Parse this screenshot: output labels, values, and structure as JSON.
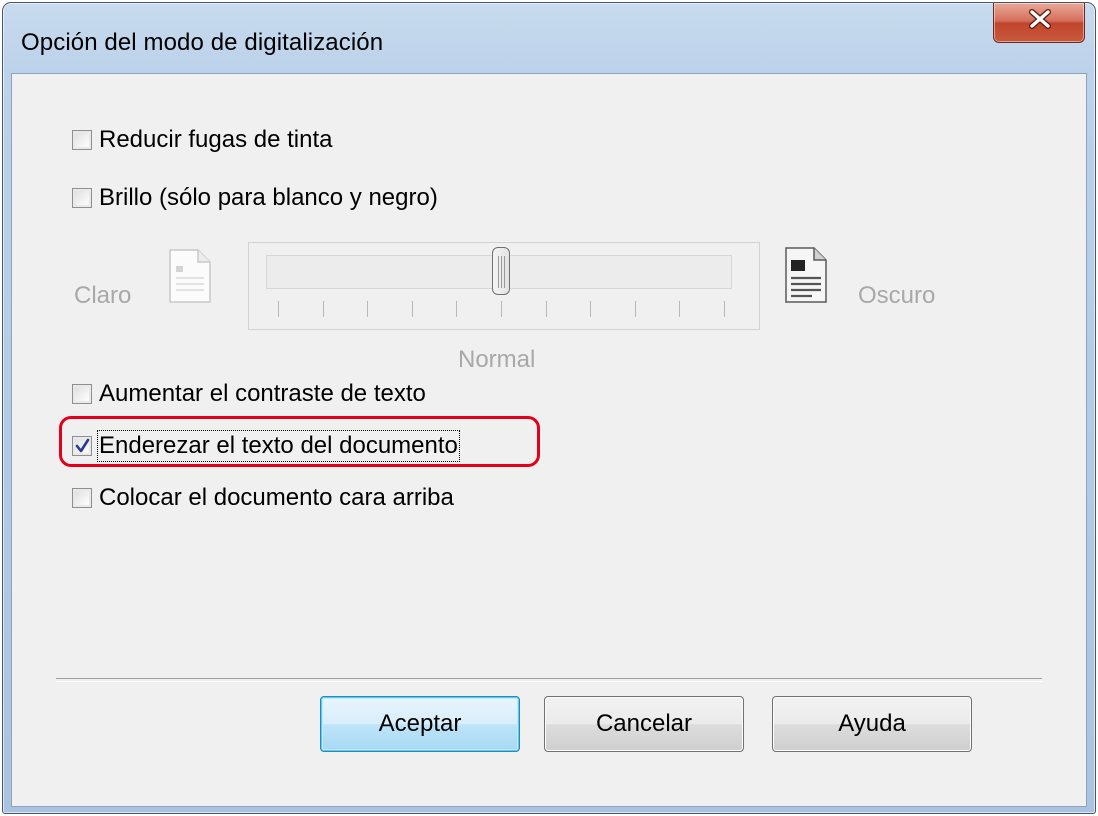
{
  "window": {
    "title": "Opción del modo de digitalización"
  },
  "options": [
    {
      "label": "Reducir fugas de tinta",
      "checked": false
    },
    {
      "label": "Brillo (sólo para blanco y negro)",
      "checked": false
    },
    {
      "label": "Aumentar el contraste de texto",
      "checked": false
    },
    {
      "label": "Enderezar el texto del documento",
      "checked": true
    },
    {
      "label": "Colocar el documento cara arriba",
      "checked": false
    }
  ],
  "brightness": {
    "left_label": "Claro",
    "right_label": "Oscuro",
    "center_label": "Normal",
    "value": 0.5,
    "enabled": false,
    "left_icon": "light-page-icon",
    "right_icon": "dark-page-icon"
  },
  "buttons": {
    "ok": "Aceptar",
    "cancel": "Cancelar",
    "help": "Ayuda"
  },
  "colors": {
    "highlight": "#e2001a",
    "close_button": "#c1442c",
    "default_button": "#3c7fb1"
  }
}
